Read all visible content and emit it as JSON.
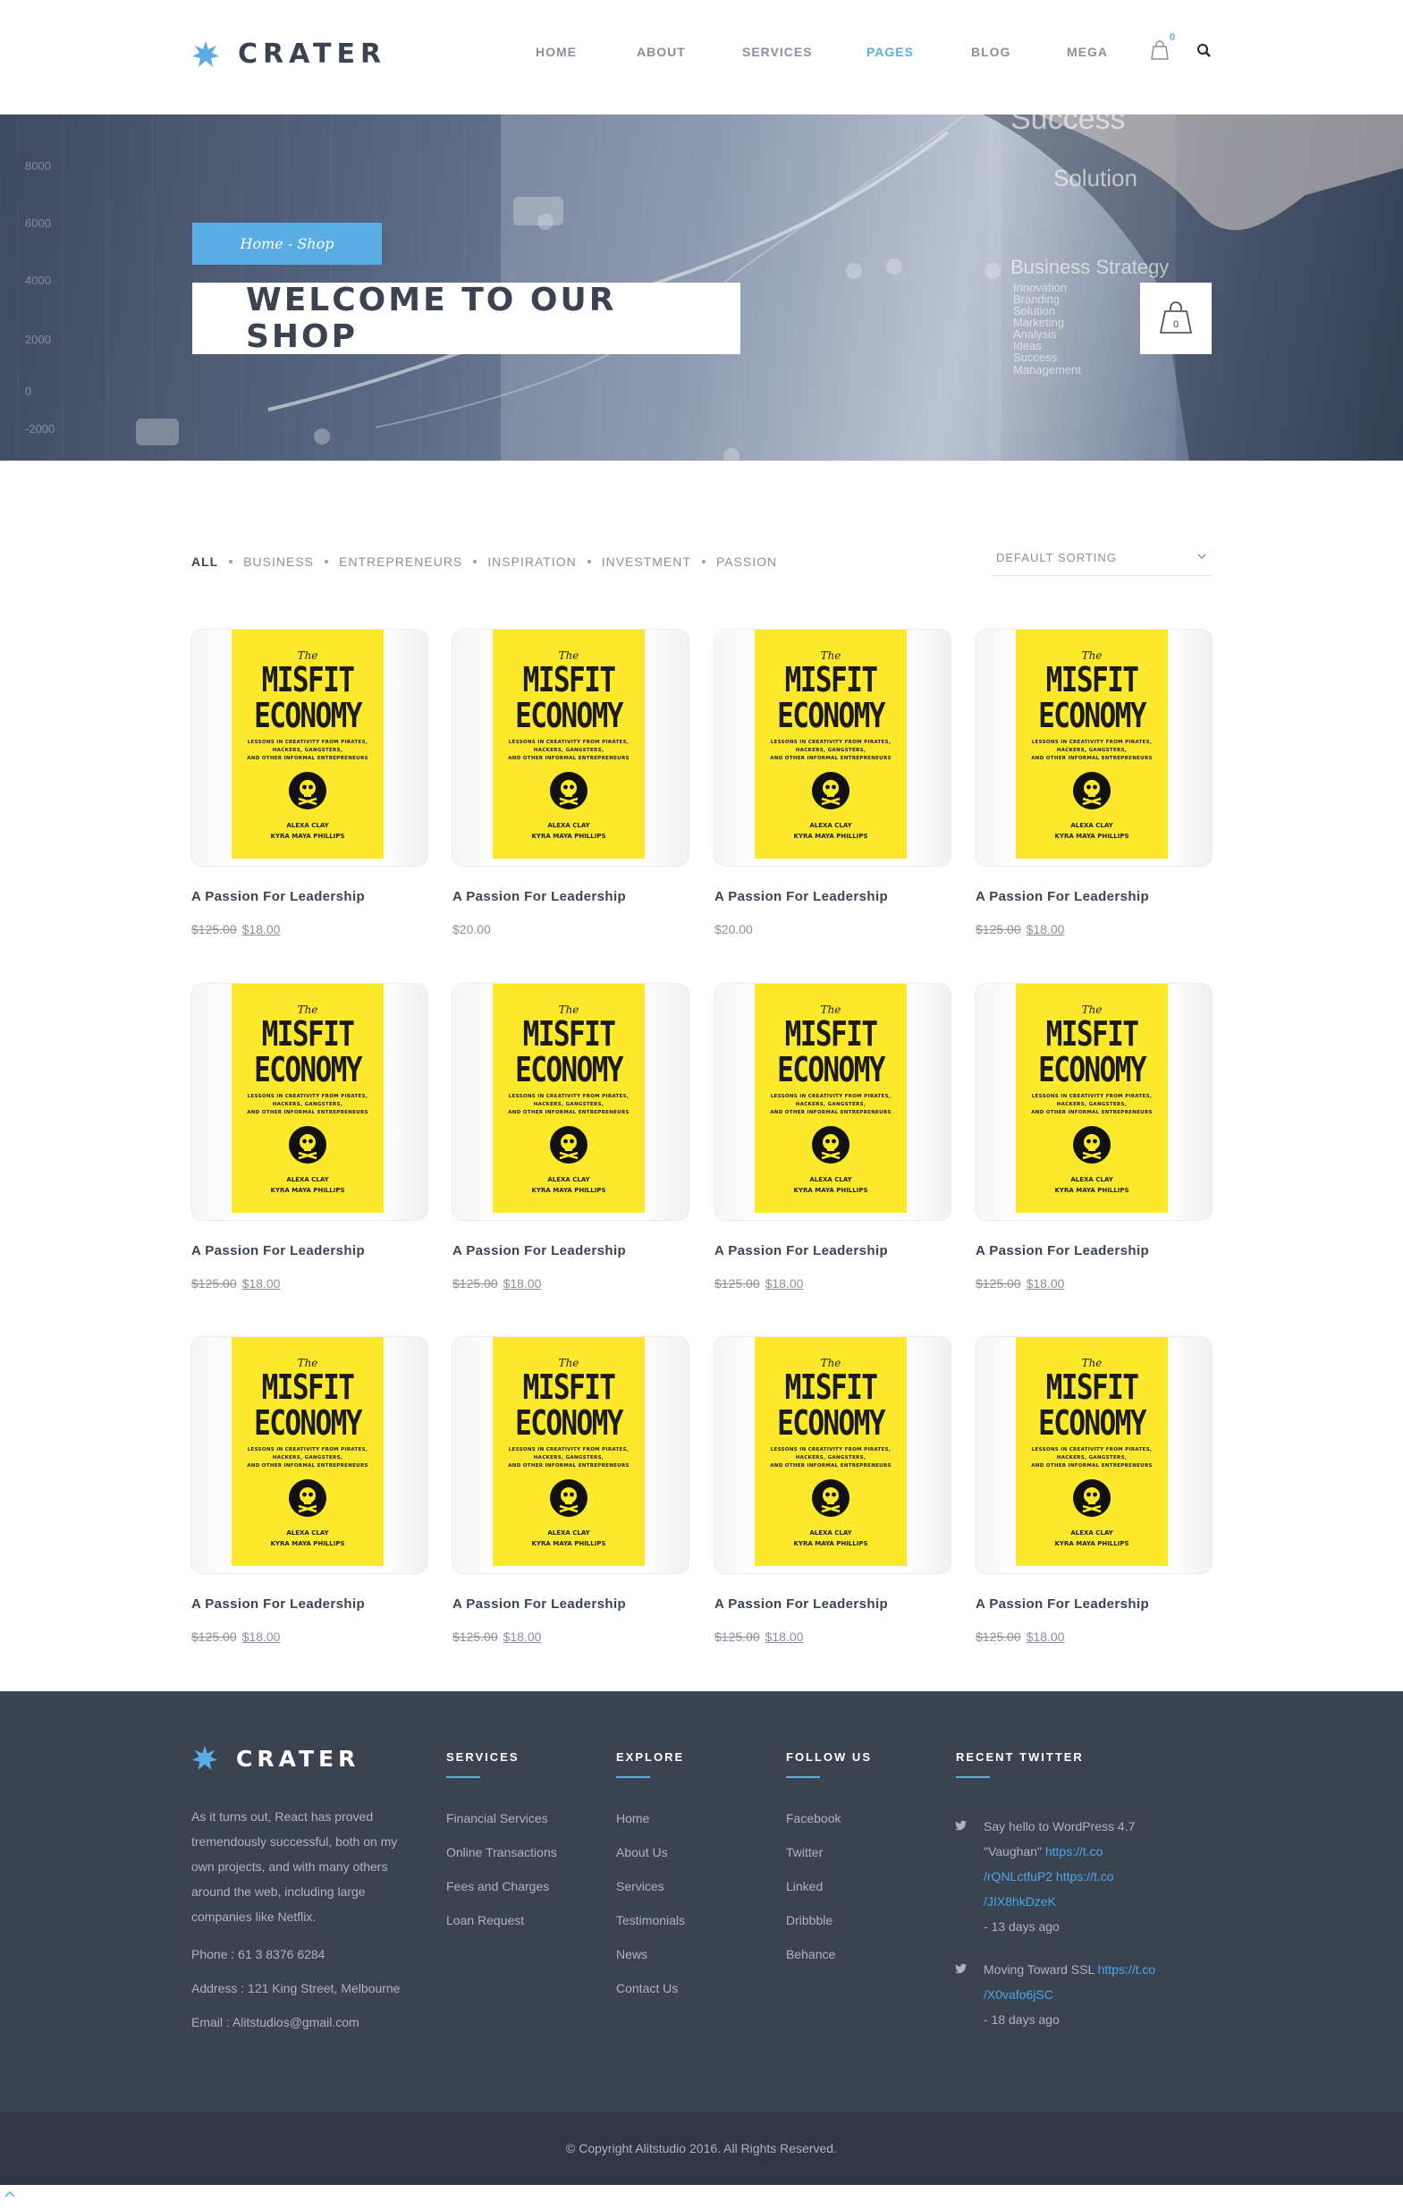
{
  "brand": {
    "name": "CRATER"
  },
  "nav": {
    "items": [
      {
        "label": "HOME",
        "active": false
      },
      {
        "label": "ABOUT",
        "active": false
      },
      {
        "label": "SERVICES",
        "active": false
      },
      {
        "label": "PAGES",
        "active": true
      },
      {
        "label": "BLOG",
        "active": false
      },
      {
        "label": "MEGA",
        "active": false
      }
    ],
    "cart_count": "0"
  },
  "hero": {
    "breadcrumb": "Home - Shop",
    "title": "WELCOME TO OUR SHOP",
    "cart_count": "0",
    "bg_axis_labels": [
      "8000",
      "6000",
      "4000",
      "2000",
      "0",
      "-2000"
    ],
    "bg_words": [
      "Success",
      "Solution",
      "Business Strategy",
      "Innovation",
      "Branding",
      "Solution",
      "Marketing",
      "Analysis",
      "Ideas",
      "Success",
      "Management"
    ]
  },
  "filters": {
    "items": [
      "ALL",
      "BUSINESS",
      "ENTREPRENEURS",
      "INSPIRATION",
      "INVESTMENT",
      "PASSION"
    ],
    "active": "ALL",
    "sort_label": "DEFAULT SORTING"
  },
  "book_cover": {
    "the": "The",
    "line1": "MISFIT",
    "line2": "ECONOMY",
    "subtitle": [
      "LESSONS IN CREATIVITY FROM PIRATES,",
      "HACKERS, GANGSTERS,",
      "AND OTHER INFORMAL ENTREPRENEURS"
    ],
    "authors": [
      "ALEXA CLAY",
      "KYRA MAYA PHILLIPS"
    ]
  },
  "products": [
    {
      "name": "A Passion For Leadership",
      "old_price": "$125.00",
      "price": "$18.00"
    },
    {
      "name": "A Passion For Leadership",
      "old_price": "",
      "price": "$20.00"
    },
    {
      "name": "A Passion For Leadership",
      "old_price": "",
      "price": "$20.00"
    },
    {
      "name": "A Passion For Leadership",
      "old_price": "$125.00",
      "price": "$18.00"
    },
    {
      "name": "A Passion For Leadership",
      "old_price": "$125.00",
      "price": "$18.00"
    },
    {
      "name": "A Passion For Leadership",
      "old_price": "$125.00",
      "price": "$18.00"
    },
    {
      "name": "A Passion For Leadership",
      "old_price": "$125.00",
      "price": "$18.00"
    },
    {
      "name": "A Passion For Leadership",
      "old_price": "$125.00",
      "price": "$18.00"
    },
    {
      "name": "A Passion For Leadership",
      "old_price": "$125.00",
      "price": "$18.00"
    },
    {
      "name": "A Passion For Leadership",
      "old_price": "$125.00",
      "price": "$18.00"
    },
    {
      "name": "A Passion For Leadership",
      "old_price": "$125.00",
      "price": "$18.00"
    },
    {
      "name": "A Passion For Leadership",
      "old_price": "$125.00",
      "price": "$18.00"
    }
  ],
  "footer": {
    "brand": "CRATER",
    "about": "As it turns out, React has proved tremendously successful, both on my own projects, and with many others around the web, including large companies like Netflix.",
    "phone": "Phone : 61 3 8376 6284",
    "address": "Address : 121 King Street, Melbourne",
    "email": "Email : Alitstudios@gmail.com",
    "columns": [
      {
        "heading": "SERVICES",
        "links": [
          "Financial Services",
          "Online Transactions",
          "Fees and Charges",
          "Loan Request"
        ]
      },
      {
        "heading": "EXPLORE",
        "links": [
          "Home",
          "About Us",
          "Services",
          "Testimonials",
          "News",
          "Contact Us"
        ]
      },
      {
        "heading": "FOLLOW US",
        "links": [
          "Facebook",
          "Twitter",
          "Linked",
          "Dribbble",
          "Behance"
        ]
      }
    ],
    "twitter_heading": "RECENT TWITTER",
    "tweets": [
      {
        "lines": [
          {
            "text": "Say hello to WordPress 4.7",
            "link": false
          },
          {
            "text": "\"Vaughan\" ",
            "link": false,
            "tail": "https://t.co"
          },
          {
            "text": "/rQNLctfuP2 https://t.co",
            "link": true
          },
          {
            "text": "/JIX8hkDzeK",
            "link": true
          },
          {
            "text": "- 13 days ago",
            "link": false
          }
        ]
      },
      {
        "lines": [
          {
            "text": "Moving Toward SSL ",
            "link": false,
            "tail": "https://t.co"
          },
          {
            "text": "/X0vafo6jSC",
            "link": true
          },
          {
            "text": "- 18 days ago",
            "link": false
          }
        ]
      }
    ],
    "copyright": "© Copyright Alitstudio 2016. All Rights Reserved."
  },
  "colors": {
    "accent": "#5aaee3",
    "dark": "#3b4351",
    "footer_bg": "#3b4250",
    "book": "#fde92b"
  }
}
